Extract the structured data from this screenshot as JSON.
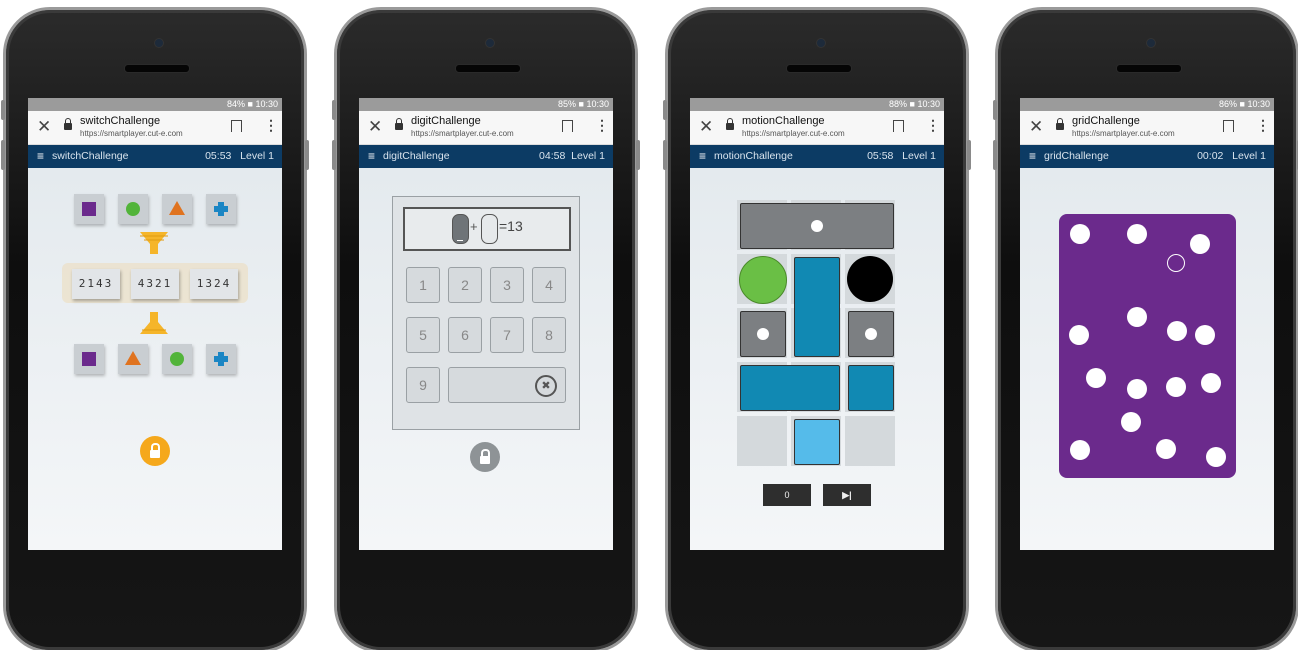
{
  "phones": [
    {
      "status": "84% ■ 10:30",
      "tab_title": "switchChallenge",
      "url": "https://smartplayer.cut-e.com",
      "app_title": "switchChallenge",
      "timer": "05:53",
      "level": "Level 1",
      "codes": [
        "2143",
        "4321",
        "1324"
      ],
      "lock_color": "#f5a81c"
    },
    {
      "status": "85% ■ 10:30",
      "tab_title": "digitChallenge",
      "url": "https://smartplayer.cut-e.com",
      "app_title": "digitChallenge",
      "timer": "04:58",
      "level": "Level 1",
      "equation": {
        "op": "+",
        "result": "=13"
      },
      "keys": [
        "1",
        "2",
        "3",
        "4",
        "5",
        "6",
        "7",
        "8",
        "9"
      ],
      "delete_symbol": "✖",
      "lock_color": "#8e9396"
    },
    {
      "status": "88% ■ 10:30",
      "tab_title": "motionChallenge",
      "url": "https://smartplayer.cut-e.com",
      "app_title": "motionChallenge",
      "timer": "05:58",
      "level": "Level 1",
      "move_count": "0",
      "skip_symbol": "▶|"
    },
    {
      "status": "86% ■ 10:30",
      "tab_title": "gridChallenge",
      "url": "https://smartplayer.cut-e.com",
      "app_title": "gridChallenge",
      "timer": "00:02",
      "level": "Level 1",
      "board_color": "#6b2a8c"
    }
  ],
  "icons": {
    "close": "✕",
    "menu": "⋮",
    "hamburger": "≡"
  }
}
